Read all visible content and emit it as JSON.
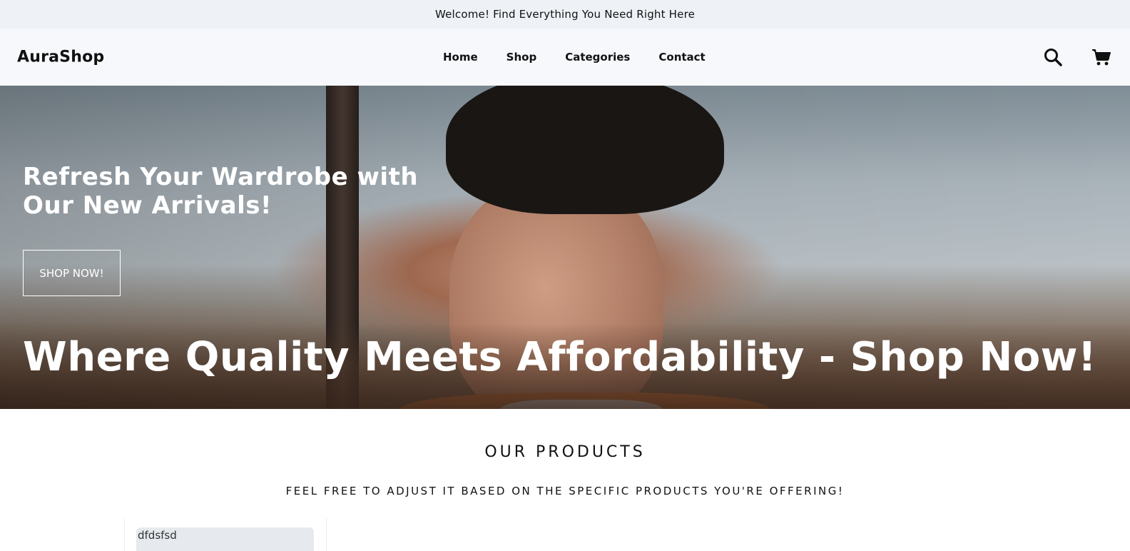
{
  "topbar": {
    "message": "Welcome! Find Everything You Need Right Here"
  },
  "header": {
    "logo": "AuraShop",
    "nav": [
      {
        "label": "Home"
      },
      {
        "label": "Shop"
      },
      {
        "label": "Categories"
      },
      {
        "label": "Contact"
      }
    ],
    "icons": [
      "search-icon",
      "cart-icon"
    ]
  },
  "hero": {
    "title_line1": "Refresh Your Wardrobe with",
    "title_line2": "Our New Arrivals!",
    "button_label": "SHOP NOW!",
    "tagline": "Where Quality Meets Affordability - Shop Now!"
  },
  "products": {
    "title": "OUR PRODUCTS",
    "subtitle": "FEEL FREE TO ADJUST IT BASED ON THE SPECIFIC PRODUCTS YOU'RE OFFERING!",
    "items": [
      {
        "image_alt": "dfdsfsd"
      }
    ]
  }
}
